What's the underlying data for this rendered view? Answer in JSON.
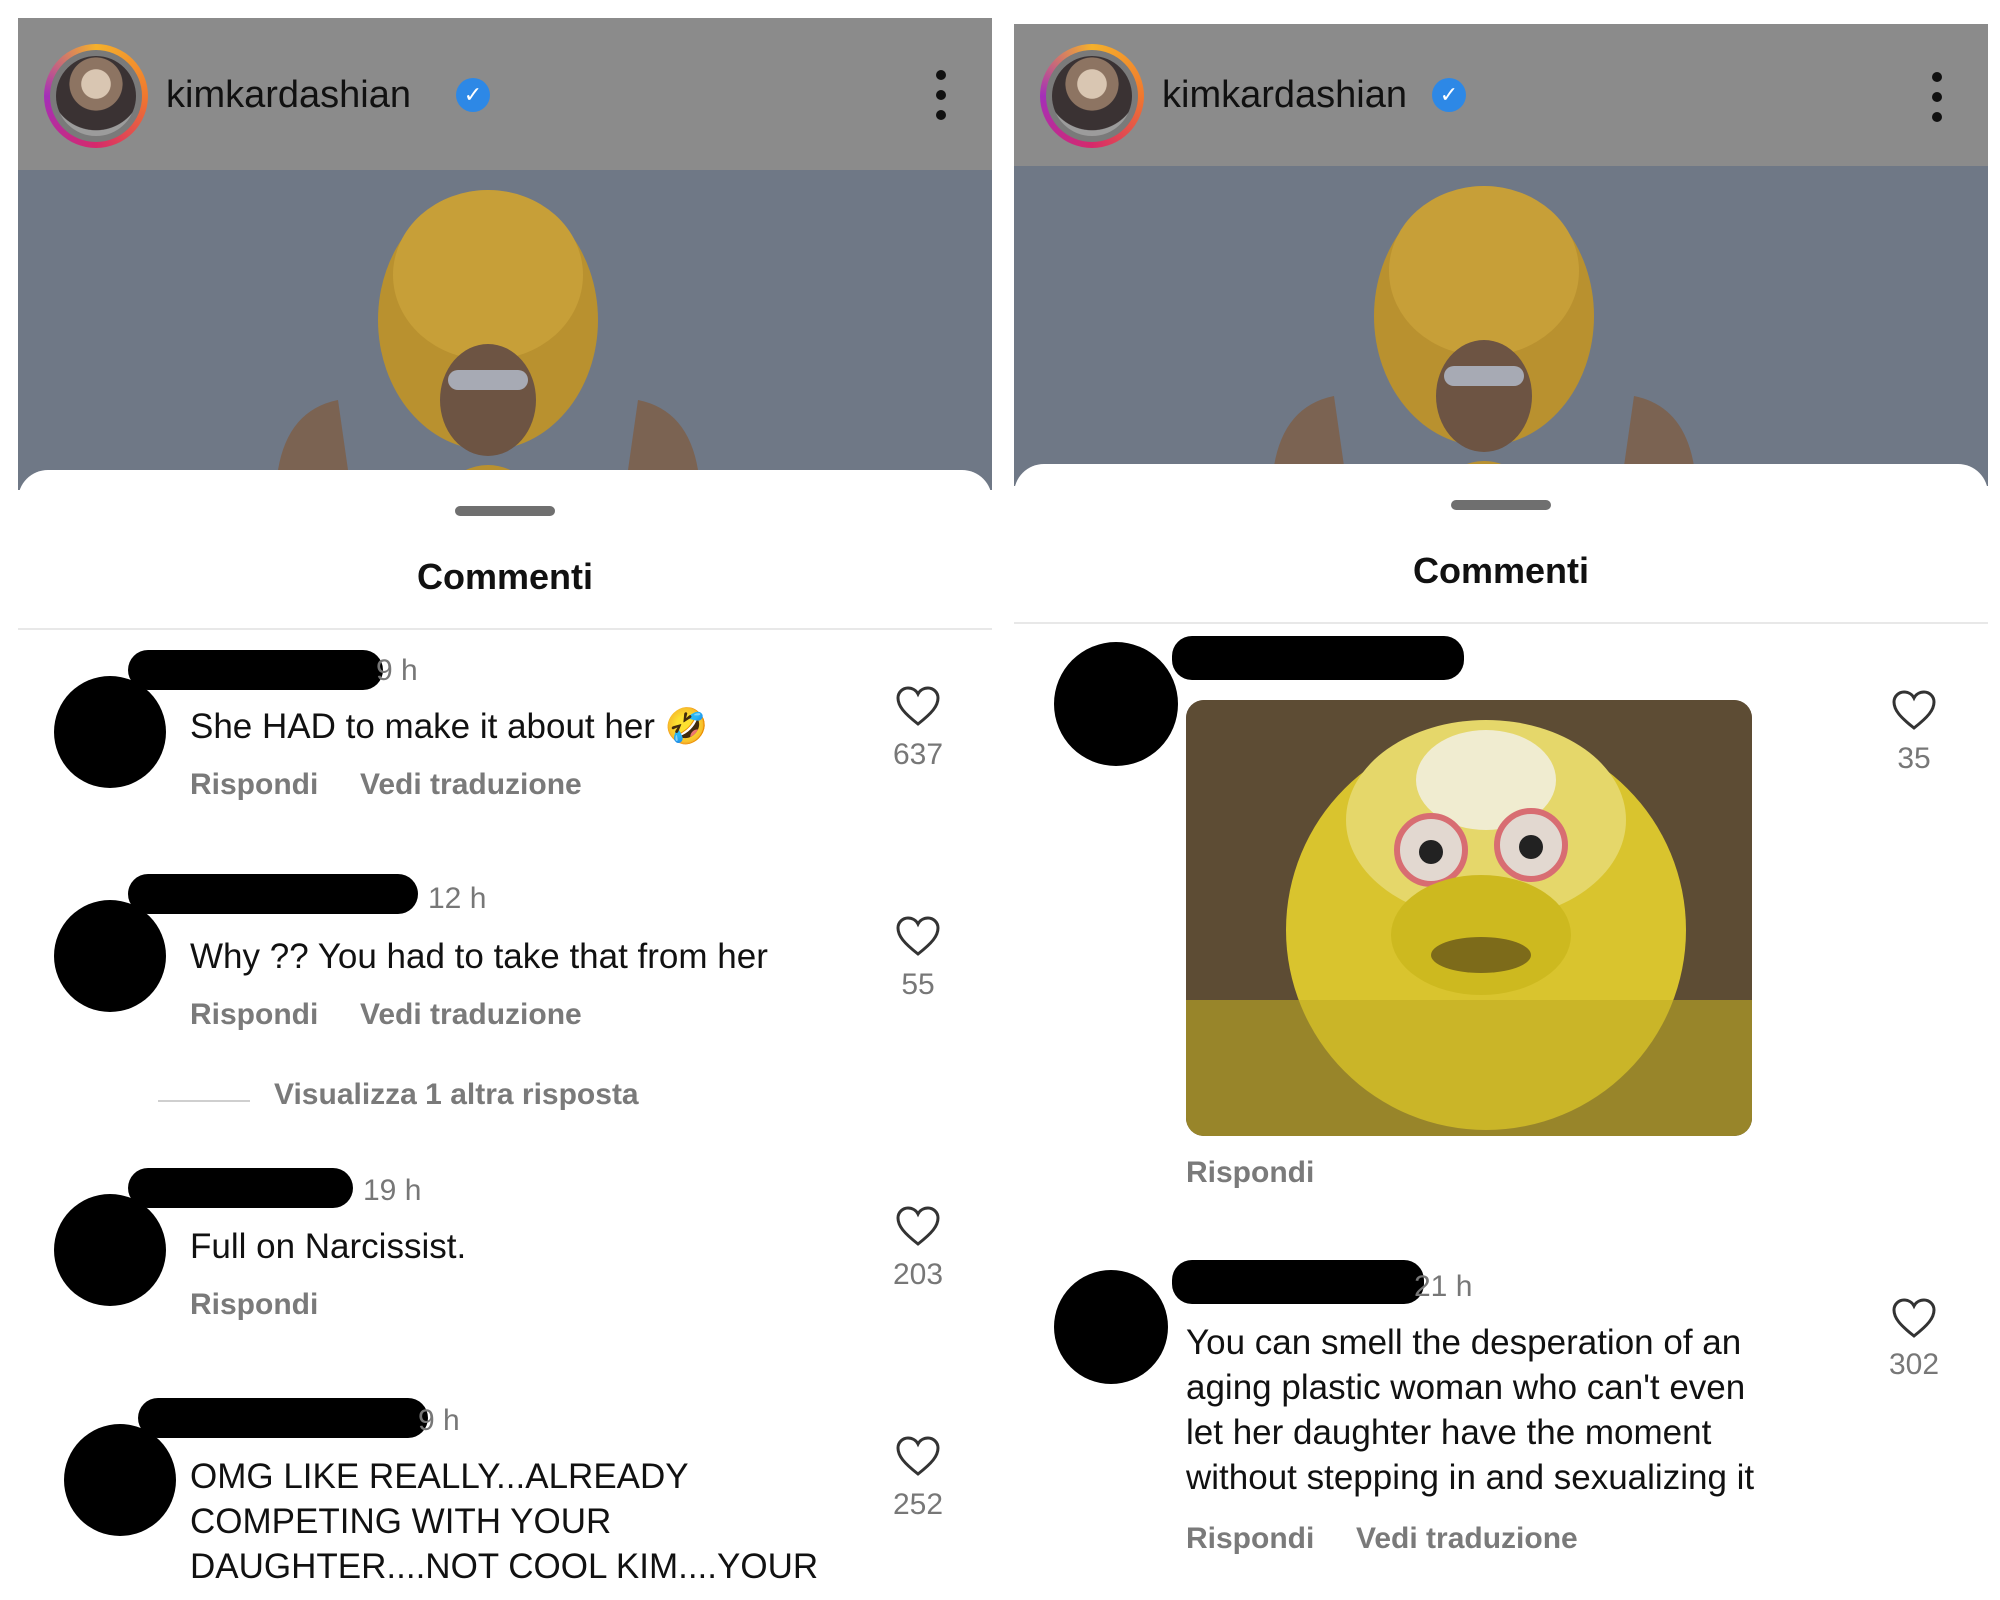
{
  "left": {
    "header": {
      "username": "kimkardashian",
      "verified": true
    },
    "sheet_title": "Commenti",
    "comments": [
      {
        "time": "9 h",
        "text": "She HAD to make it about her 🤣",
        "actions": [
          "Rispondi",
          "Vedi traduzione"
        ],
        "likes": "637"
      },
      {
        "time": "12 h",
        "text": "Why ?? You had to take that from her",
        "actions": [
          "Rispondi",
          "Vedi traduzione"
        ],
        "likes": "55",
        "more_replies": "Visualizza 1 altra risposta"
      },
      {
        "time": "19 h",
        "text": "Full on Narcissist.",
        "actions": [
          "Rispondi"
        ],
        "likes": "203"
      },
      {
        "time": "9 h",
        "text_lines": [
          "OMG LIKE REALLY...ALREADY",
          "COMPETING WITH YOUR",
          "DAUGHTER....NOT COOL KIM....YOUR"
        ],
        "likes": "252"
      }
    ]
  },
  "right": {
    "header": {
      "username": "kimkardashian",
      "verified": true
    },
    "sheet_title": "Commenti",
    "comments": [
      {
        "gif": "big-bird-gif",
        "actions": [
          "Rispondi"
        ],
        "likes": "35"
      },
      {
        "time": "21 h",
        "text_lines": [
          "You can smell the desperation of an",
          "aging plastic woman who can't even",
          "let her daughter have the moment",
          "without stepping in and sexualizing it"
        ],
        "actions": [
          "Rispondi",
          "Vedi traduzione"
        ],
        "likes": "302"
      }
    ]
  },
  "icons": {
    "more": "kebab-icon",
    "like": "heart-icon",
    "verified": "verified-badge-icon"
  },
  "colors": {
    "verified": "#2d88e6",
    "header_bg": "#8b8b8b",
    "meta_text": "#777777"
  }
}
